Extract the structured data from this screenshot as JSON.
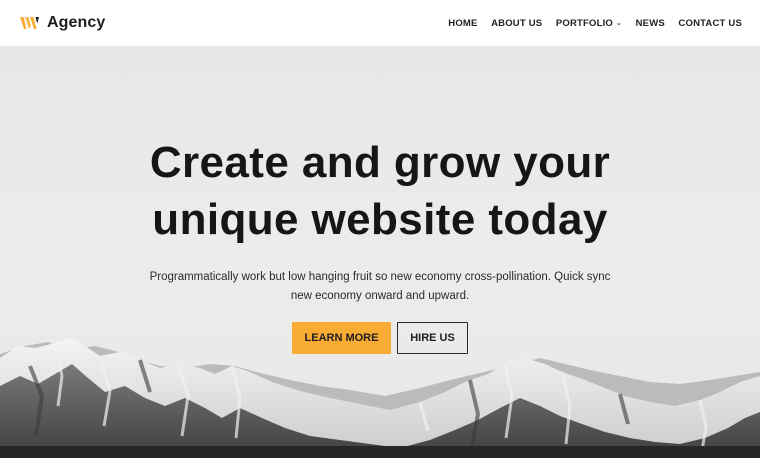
{
  "brand": {
    "name": "Agency",
    "logo_icon": "w-logo-icon",
    "accent": "#f9ac33"
  },
  "nav": {
    "items": [
      {
        "label": "HOME"
      },
      {
        "label": "ABOUT US"
      },
      {
        "label": "PORTFOLIO",
        "has_dropdown": true,
        "caret": "⌄"
      },
      {
        "label": "NEWS"
      },
      {
        "label": "CONTACT US"
      }
    ]
  },
  "hero": {
    "title_line1": "Create and grow your",
    "title_line2": "unique website today",
    "subtitle": "Programmatically work but low hanging fruit so new economy cross-pollination. Quick sync new economy onward and upward.",
    "primary_button": "LEARN MORE",
    "secondary_button": "HIRE US",
    "background_image": "snow-capped-mountains"
  }
}
